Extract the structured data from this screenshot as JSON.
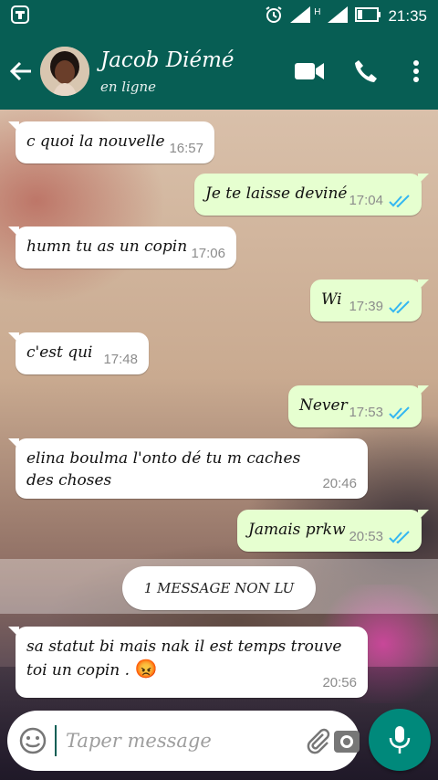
{
  "status_bar": {
    "time": "21:35",
    "network_label": "H"
  },
  "header": {
    "contact_name": "Jacob Diémé",
    "contact_status": "en ligne"
  },
  "messages": [
    {
      "direction": "in",
      "text": "c quoi la nouvelle",
      "time": "16:57"
    },
    {
      "direction": "out",
      "text": "Je te laisse deviné",
      "time": "17:04",
      "read": true
    },
    {
      "direction": "in",
      "text": "humn tu as un copin",
      "time": "17:06"
    },
    {
      "direction": "out",
      "text": "Wi",
      "time": "17:39",
      "read": true
    },
    {
      "direction": "in",
      "text": "c'est qui",
      "time": "17:48"
    },
    {
      "direction": "out",
      "text": "Never",
      "time": "17:53",
      "read": true
    },
    {
      "direction": "in",
      "text": "elina boulma l'onto dé tu m caches des choses",
      "time": "20:46"
    },
    {
      "direction": "out",
      "text": "Jamais prkw",
      "time": "20:53",
      "read": true
    },
    {
      "direction": "in",
      "text": "sa statut bi mais nak il est temps trouve toi un copin .",
      "emoji": "😡",
      "time": "20:56"
    }
  ],
  "unread_divider": "1 MESSAGE NON LU",
  "composer": {
    "placeholder": "Taper message"
  },
  "colors": {
    "header": "#075e54",
    "outgoing_bubble": "#e6ffd0",
    "incoming_bubble": "#ffffff",
    "mic_button": "#00897b",
    "read_ticks": "#34b7f1"
  },
  "icons": [
    "back-arrow-icon",
    "video-call-icon",
    "phone-icon",
    "more-options-icon",
    "emoji-icon",
    "attach-icon",
    "camera-icon",
    "mic-icon"
  ]
}
